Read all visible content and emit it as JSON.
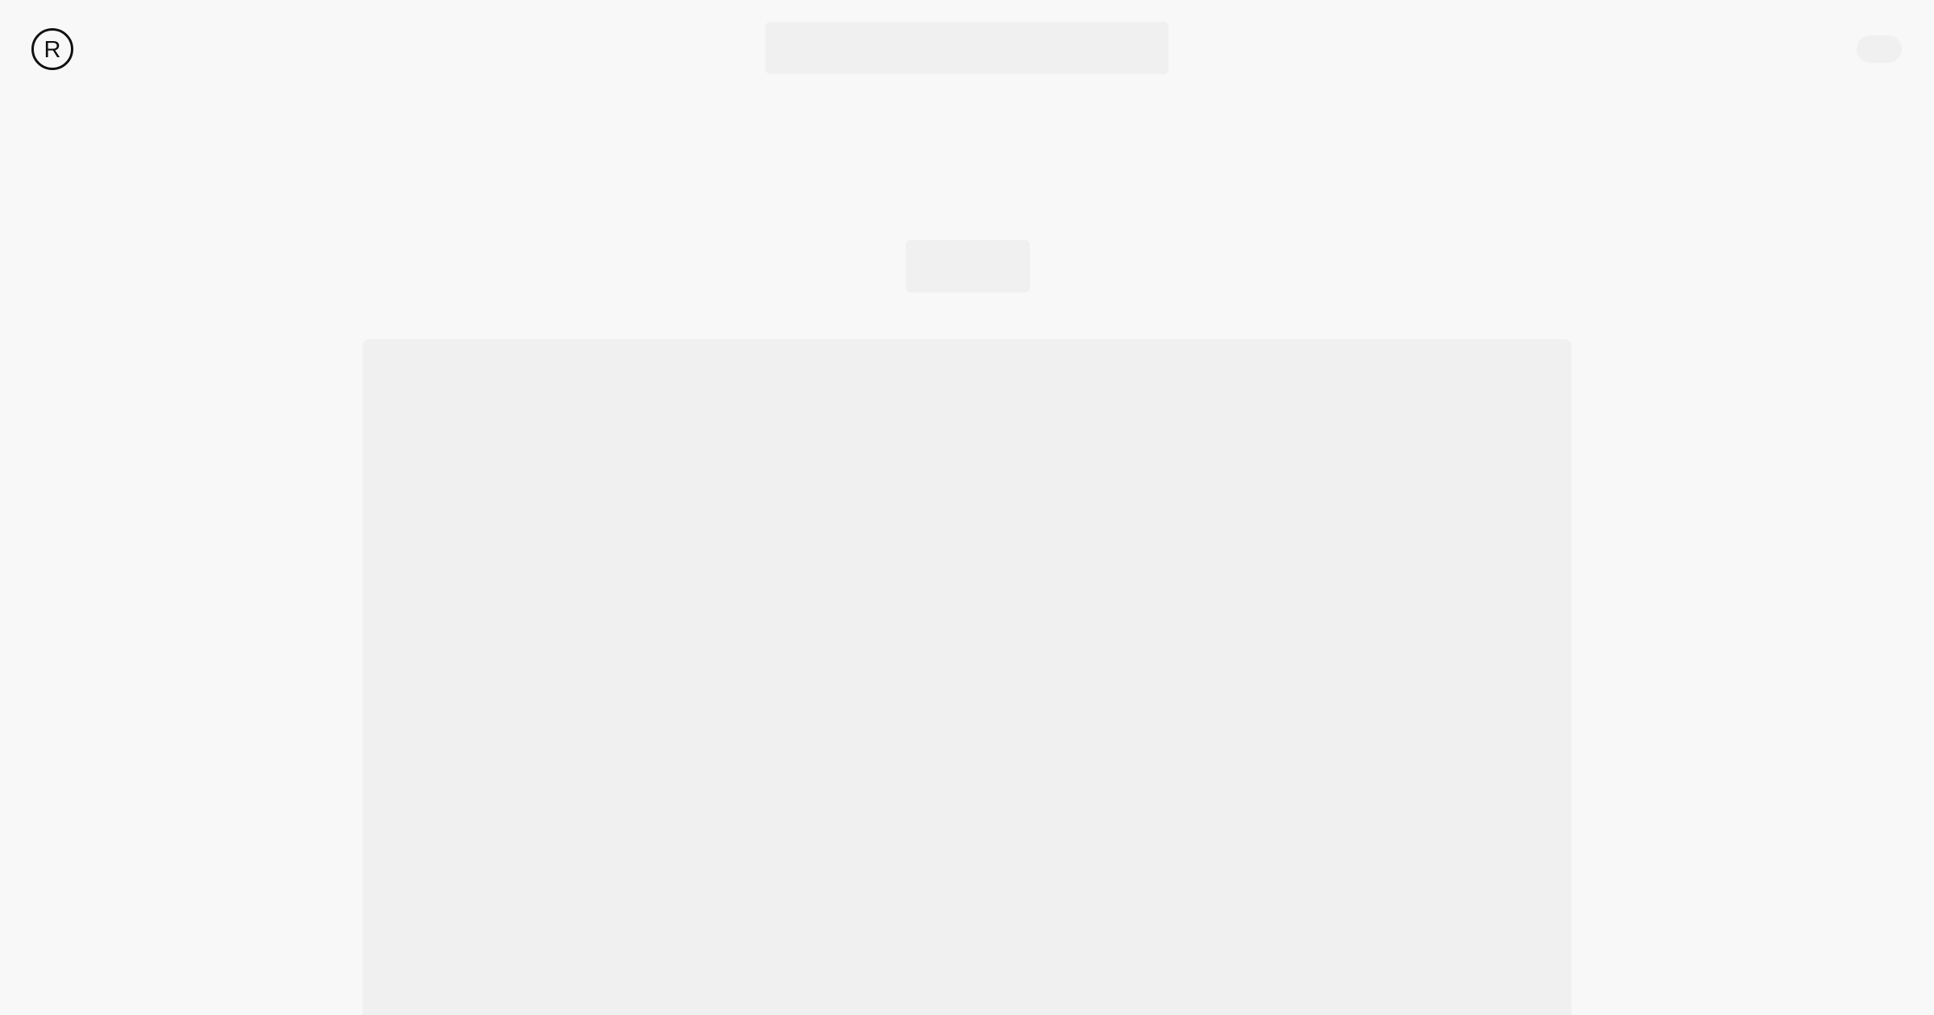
{
  "header": {
    "logo": {
      "icon": "registered-r-icon",
      "letter": "R",
      "color": "#111111"
    }
  },
  "colors": {
    "background": "#f8f8f8",
    "skeleton": "#f0f0f0"
  },
  "loading_placeholders": [
    "search-bar-skeleton",
    "user-menu-skeleton",
    "page-title-skeleton",
    "main-content-skeleton"
  ]
}
